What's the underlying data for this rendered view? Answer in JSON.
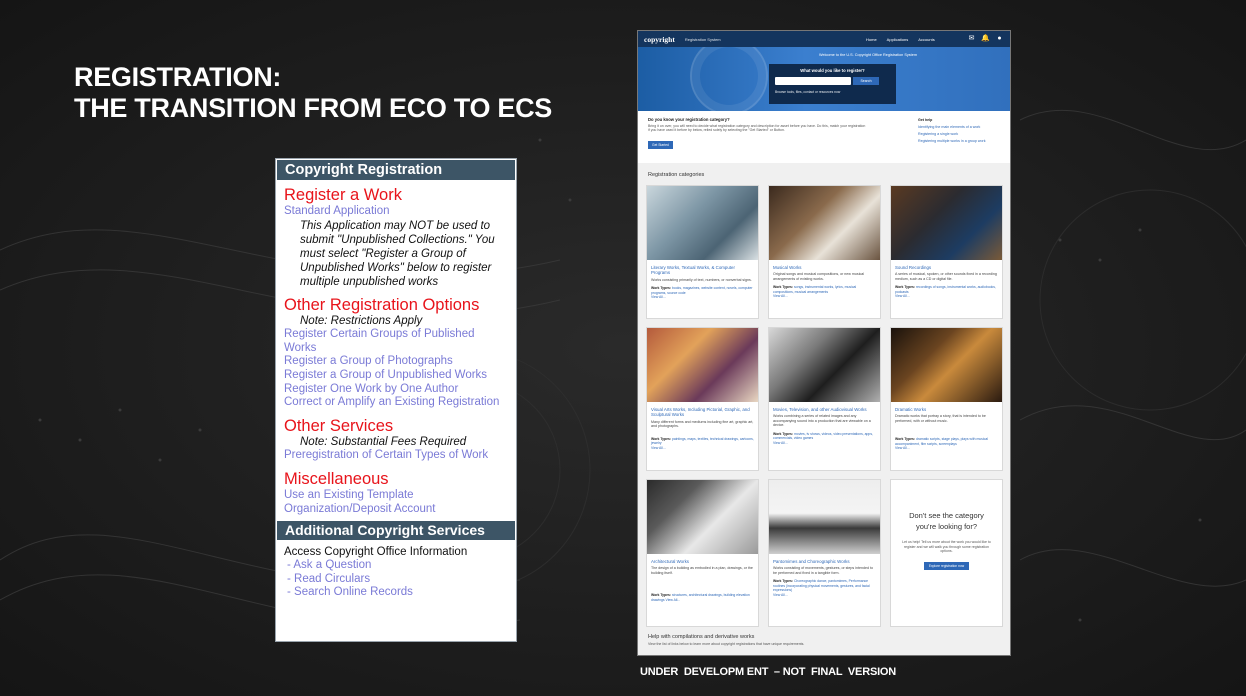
{
  "slide": {
    "title_line1": "REGISTRATION:",
    "title_line2": "THE TRANSITION FROM ECO TO ECS",
    "footer": "UNDER  DEVELOPM ENT  – NOT  FINAL  VERSION"
  },
  "eco": {
    "header": "Copyright Registration",
    "register_work": {
      "title": "Register a Work",
      "link": "Standard Application",
      "note": "This Application may NOT be used to submit \"Unpublished Collections.\" You must select \"Register a Group of Unpublished Works\" below to register multiple unpublished works"
    },
    "other_options": {
      "title": "Other Registration Options",
      "note": "Note: Restrictions Apply",
      "links": [
        "Register Certain Groups of Published Works",
        "Register a Group of Photographs",
        "Register a Group of Unpublished Works",
        "Register One Work by One Author",
        "Correct or Amplify an Existing Registration"
      ]
    },
    "other_services": {
      "title": "Other Services",
      "note": "Note: Substantial Fees Required",
      "links": [
        "Preregistration of Certain Types of Work"
      ]
    },
    "misc": {
      "title": "Miscellaneous",
      "links": [
        "Use an Existing Template",
        "Organization/Deposit Account"
      ]
    },
    "additional": {
      "header": "Additional Copyright Services",
      "intro": "Access Copyright Office Information",
      "links": [
        "- Ask a Question",
        "- Read Circulars",
        "- Search Online Records"
      ]
    }
  },
  "ecs": {
    "logo": "copyright",
    "system": "Registration System",
    "nav": [
      "Home",
      "Applications",
      "Accounts"
    ],
    "icons": [
      "mail-icon",
      "bell-icon",
      "user-icon"
    ],
    "welcome": "Welcome to the U.S. Copyright Office Registration System",
    "search_question": "What would you like to register?",
    "search_button": "Search",
    "browse": "Browse tools, files, contact or resources now",
    "know_title": "Do you know your registration category?",
    "know_text": "Bring it on over, you will need to decide what registration category and description for asset before you have. Do this, match your registration if you have used it before by below, relied solely by selecting the \"Get Started\" or Button.",
    "start_button": "Get Started",
    "help_title": "Get help",
    "help_links": [
      "Identifying the main elements of a work",
      "Registering a single work",
      "Registering multiple works in a group work"
    ],
    "categories_title": "Registration categories",
    "cards": [
      {
        "title": "Literary Works, Textual Works, & Computer Programs",
        "desc": "Works consisting primarily of text, numbers, or nonverbal signs.",
        "types": "books, magazines, website content, novels, computer programs, source code",
        "view": "View All..."
      },
      {
        "title": "Musical Works",
        "desc": "Original songs and musical compositions, or new musical arrangements of existing works.",
        "types": "songs, instrumental works, lyrics, musical compositions, musical arrangements",
        "view": "View All..."
      },
      {
        "title": "Sound Recordings",
        "desc": "A series of musical, spoken, or other sounds fixed in a recording medium, such as a CD or digital file.",
        "types": "recordings of songs, instrumental works, audiobooks, podcasts",
        "view": "View All..."
      },
      {
        "title": "Visual Arts Works, Including Pictorial, Graphic, and Sculptural Works",
        "desc": "Many different forms and mediums including fine art, graphic art, and photographs.",
        "types": "paintings, maps, textiles, technical drawings, cartoons, jewelry",
        "view": "View All..."
      },
      {
        "title": "Movies, Television, and other Audiovisual Works",
        "desc": "Works combining a series of related images and any accompanying sound into a production that are viewable on a device.",
        "types": "movies, tv shows, videos, video presentations, apps, commercials, video games",
        "view": "View All..."
      },
      {
        "title": "Dramatic Works",
        "desc": "Dramatic works that portray a story, that is intended to be performed, with or without music.",
        "types": "dramatic scripts, stage plays, plays with musical accompaniment, film scripts, screenplays",
        "view": "View All..."
      },
      {
        "title": "Architectural Works",
        "desc": "The design of a building as embodied in a plan, drawings, or the building itself.",
        "types": "structures, architectural drawings, building elevation drawings",
        "view": "View All..."
      },
      {
        "title": "Pantomimes and Choreographic Works",
        "desc": "Works consisting of movements, gestures, or steps intended to be performed and fixed in a tangible form.",
        "types": "Choreographic dance, pantomimes, Performance routines (incorporating physical movements, gestures, and facial expressions)",
        "view": "View All..."
      }
    ],
    "no_see_title": "Don't see the category you're looking for?",
    "no_see_text": "Let us help! Tell us more about the work you would like to register and we will walk you through some registration options.",
    "no_see_button": "Explore registration now",
    "compile_title": "Help with compilations and derivative works",
    "compile_text": "View the list of links below to learn more about copyright registrations that have unique requirements."
  }
}
